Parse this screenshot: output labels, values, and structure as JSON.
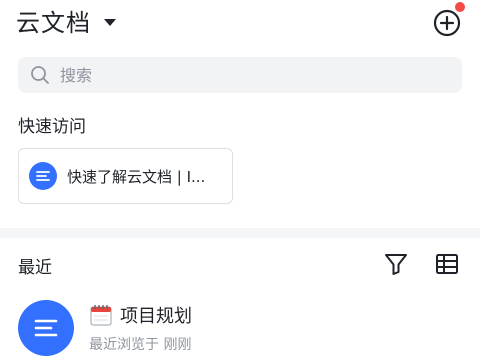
{
  "header": {
    "title": "云文档",
    "notification_dot_color": "#f54a45",
    "add_icon": "plus-circle-icon"
  },
  "search": {
    "placeholder": "搜索"
  },
  "quick_access": {
    "label": "快速访问",
    "items": [
      {
        "title": "快速了解云文档 | I...",
        "icon": "doc-icon"
      }
    ]
  },
  "recent": {
    "label": "最近",
    "filter_icon": "filter-icon",
    "view_icon": "grid-view-icon",
    "items": [
      {
        "title": "项目规划",
        "subtitle": "最近浏览于 刚刚",
        "icon": "doc-icon",
        "emoji": "calendar-icon"
      }
    ]
  },
  "colors": {
    "accent": "#3370ff",
    "text": "#1f2329",
    "secondary": "#8f959e"
  }
}
